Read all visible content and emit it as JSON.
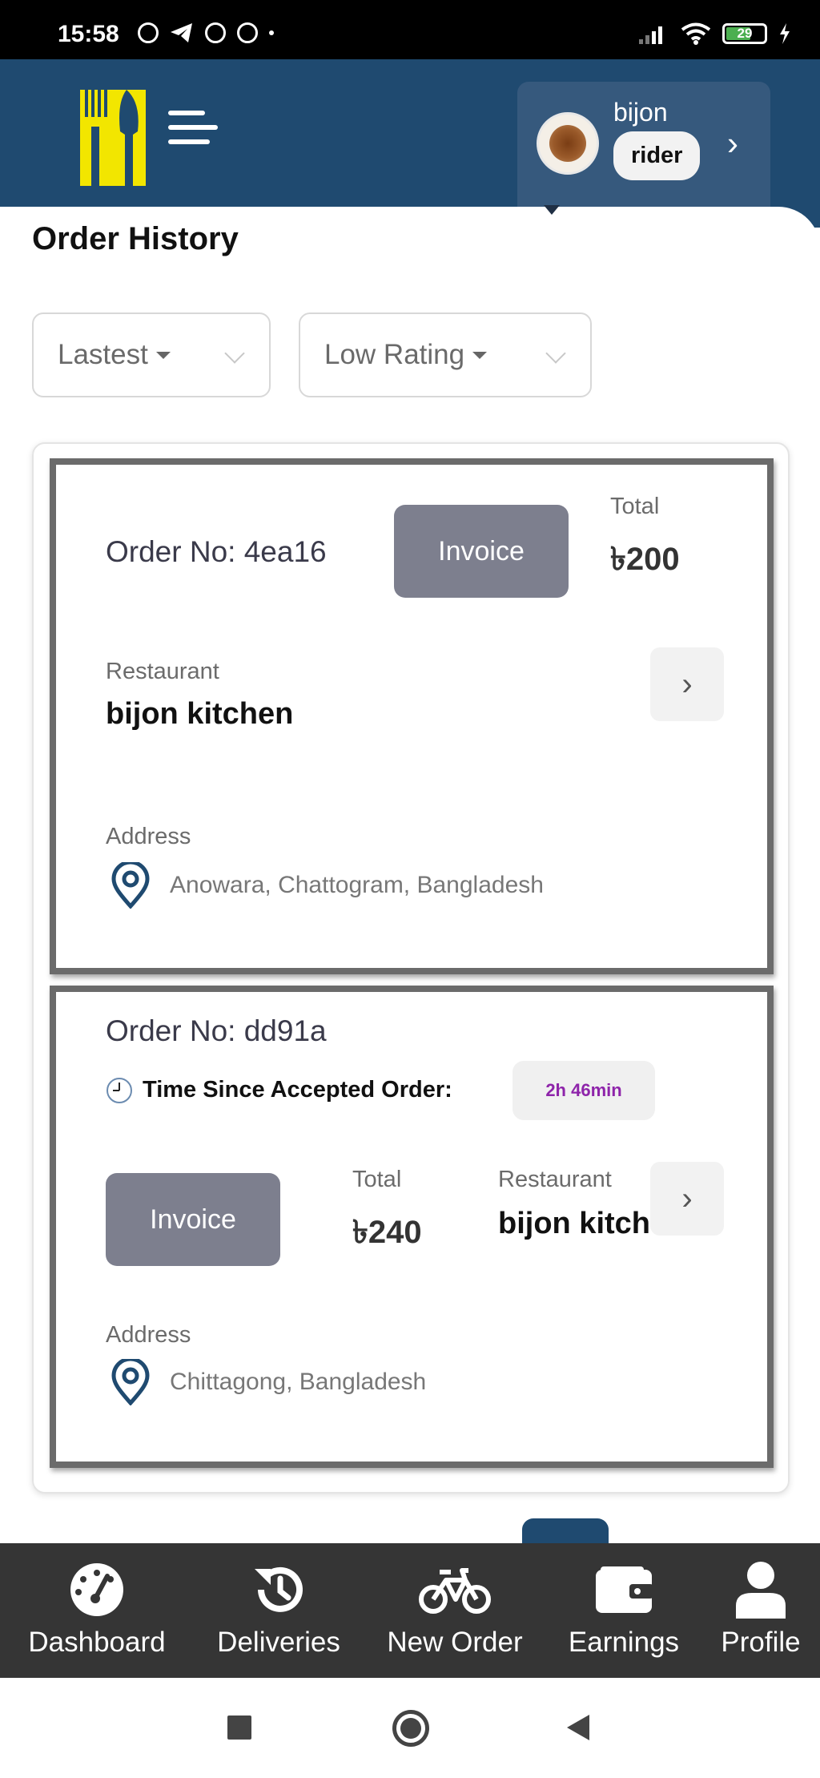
{
  "status_bar": {
    "time": "15:58",
    "battery": "29"
  },
  "header": {
    "user": {
      "name": "bijon",
      "role": "rider"
    }
  },
  "page": {
    "title": "Order History",
    "filters": [
      {
        "label": "Lastest"
      },
      {
        "label": "Low Rating"
      }
    ]
  },
  "orders": [
    {
      "order_no": "Order No: 4ea16",
      "invoice_label": "Invoice",
      "total_label": "Total",
      "total": "৳200",
      "restaurant_label": "Restaurant",
      "restaurant": "bijon kitchen",
      "address_label": "Address",
      "address": "Anowara, Chattogram, Bangladesh"
    },
    {
      "order_no": "Order No: dd91a",
      "time_label": "Time Since Accepted Order:",
      "time_value": "2h 46min",
      "invoice_label": "Invoice",
      "total_label": "Total",
      "total": "৳240",
      "restaurant_label": "Restaurant",
      "restaurant": "bijon kitch",
      "address_label": "Address",
      "address": "Chittagong, Bangladesh"
    }
  ],
  "bottom_nav": [
    {
      "label": "Dashboard",
      "icon": "dashboard-gauge-icon"
    },
    {
      "label": "Deliveries",
      "icon": "history-icon"
    },
    {
      "label": "New Order",
      "icon": "bicycle-icon"
    },
    {
      "label": "Earnings",
      "icon": "wallet-icon"
    },
    {
      "label": "Profile",
      "icon": "user-icon"
    }
  ],
  "colors": {
    "header": "#1f4a70",
    "invoice_button": "#7d7f8e",
    "bottom_nav": "#353535",
    "badge_text": "#8e24aa",
    "logo": "#f2e600"
  }
}
